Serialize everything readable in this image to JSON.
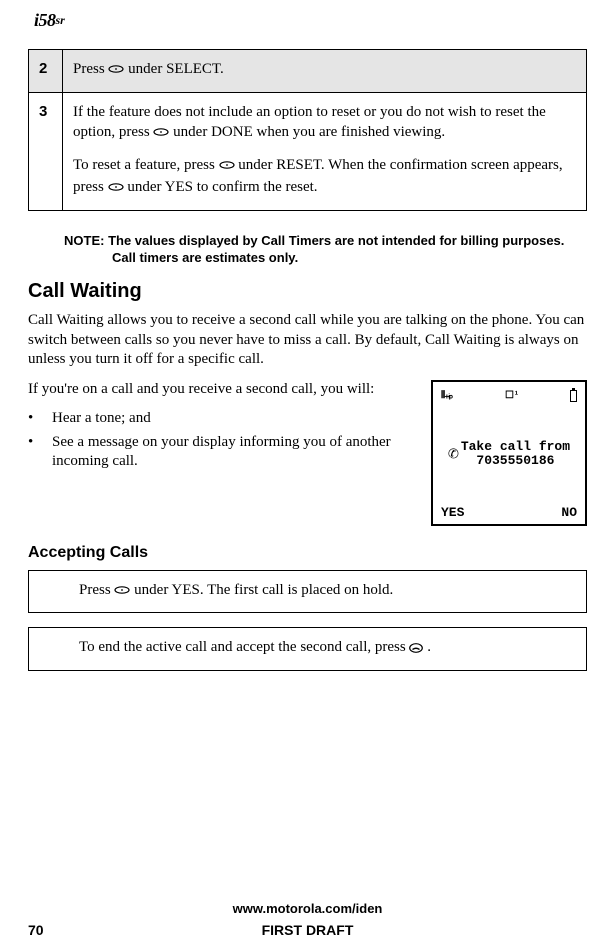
{
  "header": {
    "logo_model": "i58",
    "logo_suffix": "sr"
  },
  "steps": {
    "r2": {
      "num": "2",
      "text_before": "Press ",
      "text_after": " under SELECT."
    },
    "r3": {
      "num": "3",
      "p1_before": "If the feature does not include an option to reset or you do not wish to reset the option, press ",
      "p1_after": " under DONE when you are finished viewing.",
      "p2_before": "To reset a feature, press ",
      "p2_mid": " under RESET. When the confirmation screen appears, press ",
      "p2_after": " under YES to confirm the reset."
    }
  },
  "note": {
    "label": "NOTE:",
    "text": "The values displayed by Call Timers are not intended for billing purposes. Call timers are estimates only."
  },
  "section_title": "Call Waiting",
  "desc": "Call Waiting allows you to receive a second call while you are talking on the phone. You can switch between calls so you never have to miss a call. By default, Call Waiting is always on unless you turn it off for a specific call.",
  "lead_in": "If you're on a call and you receive a second call, you will:",
  "bullets": [
    "Hear a tone; and",
    "See a message on your display informing you of another incoming call."
  ],
  "phone": {
    "signal_glyph": "⫴₊ᵢₚ",
    "line_glyph": "☐ ¹",
    "take_line1": "Take call from",
    "take_line2": "7035550186",
    "left": "YES",
    "right": "NO"
  },
  "subheading": "Accepting Calls",
  "box1_before": "Press ",
  "box1_after": " under YES. The first call is placed on hold.",
  "box2_before": "To end the active call and accept the second call, press ",
  "box2_after": ".",
  "footer": {
    "url": "www.motorola.com/iden",
    "page": "70",
    "draft": "FIRST DRAFT"
  }
}
